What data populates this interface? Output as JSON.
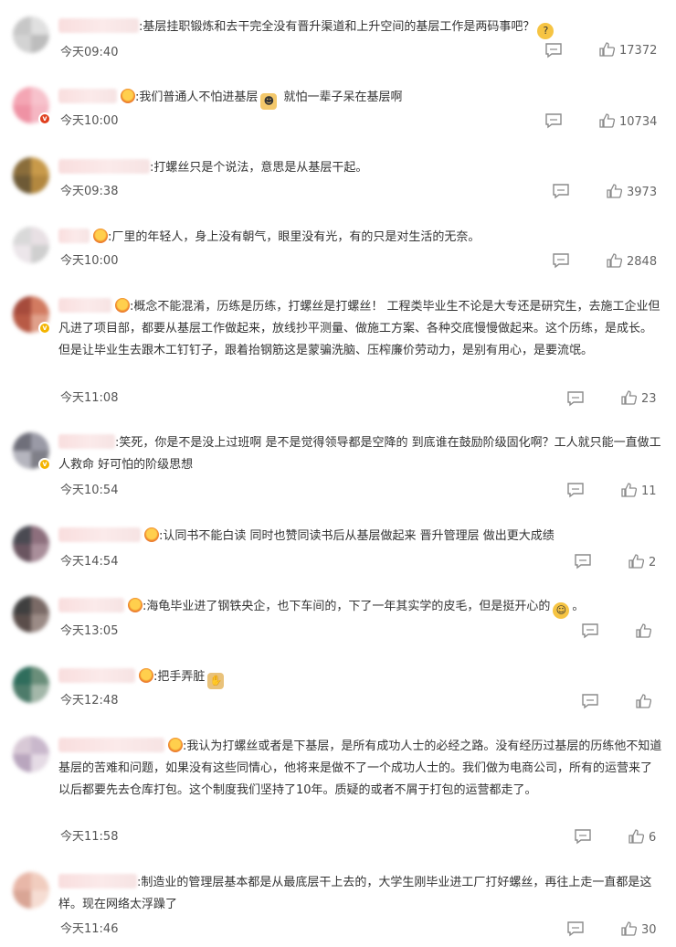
{
  "colors": {
    "text": "#333333",
    "time": "#555555",
    "icon": "#8a8a8a",
    "badge_red": "#e0401f",
    "badge_gold": "#f4b400"
  },
  "comments": [
    {
      "avatar": [
        "#c7c7c7",
        "#e0e0e0",
        "#d3d3d3",
        "#bdbdbd"
      ],
      "badge": "",
      "medal": false,
      "text": ":基层挂职锻炼和去干完全没有晋升渠道和上升空间的基层工作是两码事吧？",
      "emoji": "thinking-face-icon",
      "time": "今天09:40",
      "likes": "17372"
    },
    {
      "avatar": [
        "#f4a6b4",
        "#f7c2cc",
        "#ef92a4",
        "#f5b7c3"
      ],
      "badge": "red",
      "medal": true,
      "text": ":我们普通人不怕进基层",
      "emoji": "person-icon",
      "text2": " 就怕一辈子呆在基层啊",
      "time": "今天10:00",
      "likes": "10734"
    },
    {
      "avatar": [
        "#8a6d3b",
        "#c89a4a",
        "#6e5a36",
        "#b3883f"
      ],
      "badge": "",
      "medal": false,
      "text": ":打螺丝只是个说法，意思是从基层干起。",
      "time": "今天09:38",
      "likes": "3973"
    },
    {
      "avatar": [
        "#d9d9d9",
        "#e8e0e4",
        "#ece6ea",
        "#cfcfcf"
      ],
      "badge": "",
      "medal": true,
      "text": ":厂里的年轻人，身上没有朝气，眼里没有光，有的只是对生活的无奈。",
      "time": "今天10:00",
      "likes": "2848"
    },
    {
      "avatar": [
        "#a64b3c",
        "#d27b61",
        "#b85a45",
        "#e0a08a"
      ],
      "badge": "gold",
      "medal": true,
      "text": ":概念不能混淆，历练是历练，打螺丝是打螺丝！ 工程类毕业生不论是大专还是研究生，去施工企业但凡进了项目部，都要从基层工作做起来，放线抄平测量、做施工方案、各种交底慢慢做起来。这个历练，是成长。 但是让毕业生去跟木工钉钉子，跟着抬钢筋这是蒙骗洗脑、压榨廉价劳动力，是别有用心，是要流氓。",
      "time": "今天11:08",
      "likes": "23"
    },
    {
      "avatar": [
        "#6f6f7a",
        "#9a9aa6",
        "#b5b5be",
        "#7f7f88"
      ],
      "badge": "gold",
      "medal": false,
      "text": ":笑死，你是不是没上过班啊 是不是觉得领导都是空降的 到底谁在鼓励阶级固化啊？工人就只能一直做工人救命 好可怕的阶级思想",
      "time": "今天10:54",
      "likes": "11"
    },
    {
      "avatar": [
        "#4a4a52",
        "#8d6f7d",
        "#6a5560",
        "#a98e9a"
      ],
      "badge": "",
      "medal": true,
      "text": ":认同书不能白读 同时也赞同读书后从基层做起来 晋升管理层 做出更大成绩",
      "time": "今天14:54",
      "likes": "2"
    },
    {
      "avatar": [
        "#3f3f3f",
        "#7a6a66",
        "#5a4d4a",
        "#9b8b86"
      ],
      "badge": "",
      "medal": true,
      "text": ":海龟毕业进了钢铁央企，也下车间的，下了一年其实学的皮毛，但是挺开心的",
      "emoji": "laughing-face-icon",
      "text2": "。",
      "time": "今天13:05",
      "likes": ""
    },
    {
      "avatar": [
        "#2f6d5c",
        "#6a8e7a",
        "#4d7b6a",
        "#a3b7a9"
      ],
      "badge": "",
      "medal": true,
      "text": ":把手弄脏",
      "emoji": "hands-icon",
      "time": "今天12:48",
      "likes": ""
    },
    {
      "avatar": [
        "#d8c9d6",
        "#c9b8cc",
        "#b9a6be",
        "#e5dbe5"
      ],
      "badge": "",
      "medal": true,
      "text": ":我认为打螺丝或者是下基层，是所有成功人士的必经之路。没有经历过基层的历练他不知道基层的苦难和问题，如果没有这些同情心，他将来是做不了一个成功人士的。我们做为电商公司，所有的运营来了以后都要先去仓库打包。这个制度我们坚持了10年。质疑的或者不屑于打包的运营都走了。",
      "time": "今天11:58",
      "likes": "6"
    },
    {
      "avatar": [
        "#e8b7a8",
        "#f1cdbf",
        "#d9a595",
        "#f6ddd3"
      ],
      "badge": "",
      "medal": false,
      "text": ":制造业的管理层基本都是从最底层干上去的，大学生刚毕业进工厂打好螺丝，再往上走一直都是这样。现在网络太浮躁了",
      "time": "今天11:46",
      "likes": "30"
    }
  ]
}
